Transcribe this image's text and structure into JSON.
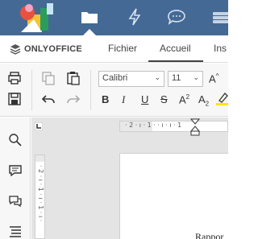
{
  "tabs": {
    "brand": "ONLYOFFICE",
    "items": [
      {
        "label": "Fichier"
      },
      {
        "label": "Accueil",
        "active": true
      },
      {
        "label": "Ins"
      }
    ]
  },
  "toolbar": {
    "font_name": "Calibri",
    "font_size": "11",
    "bold": "B",
    "italic": "I",
    "underline": "U",
    "strike": "S",
    "superscript": "A",
    "superscript_mark": "2",
    "subscript": "A",
    "subscript_mark": "2",
    "grow_font": "A",
    "grow_mark": "^"
  },
  "ruler": {
    "h_ticks": "· 2 · ı · 1 ·    · ı · ı · 1",
    "v_ticks": "· 2 · ı · 1 · ı · 1 · ı ·"
  },
  "document": {
    "visible_text": "Rappor"
  },
  "colors": {
    "nav_bg": "#446995",
    "toolbar_bg": "#f7f7f7",
    "accent_highlight": "#ffe600"
  },
  "icons": {
    "nav": [
      "folder-icon",
      "lightning-icon",
      "chat-bubble-icon",
      "stack-icon"
    ],
    "sidebar": [
      "search-icon",
      "comment-icon",
      "chat-icon",
      "navigation-icon"
    ]
  }
}
